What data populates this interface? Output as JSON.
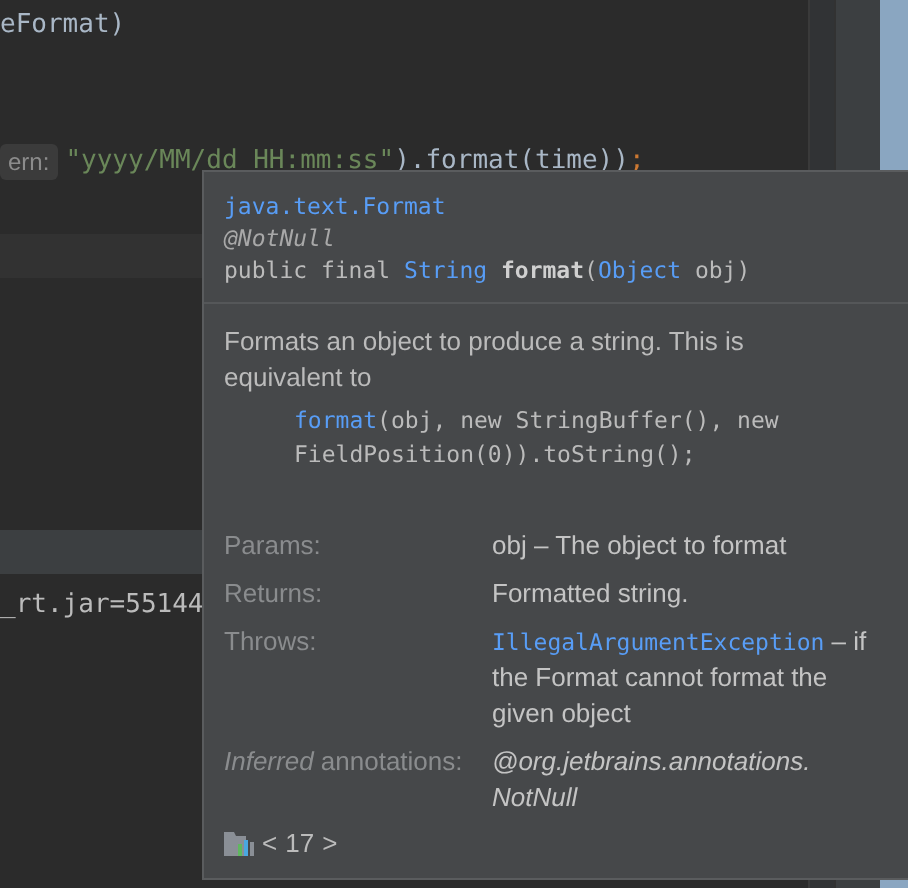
{
  "editor": {
    "lines": [
      {
        "kind": "code",
        "tokens": [
          {
            "text": "eFormat)",
            "kind": "plain"
          }
        ]
      },
      {
        "kind": "blank"
      },
      {
        "kind": "blank"
      },
      {
        "kind": "hint",
        "hint": "ern:",
        "tokens": [
          {
            "text": "\"yyyy/MM/dd HH:mm:ss\"",
            "kind": "string"
          },
          {
            "text": ").format(time))",
            "kind": "plain"
          },
          {
            "text": ";",
            "kind": "punct"
          }
        ]
      },
      {
        "kind": "blank"
      },
      {
        "kind": "current"
      }
    ]
  },
  "console": {
    "line": "_rt.jar=55144"
  },
  "popup": {
    "qualified_name": "java.text.Format",
    "annotation": "@NotNull",
    "signature": [
      {
        "text": "public final ",
        "kind": "plain"
      },
      {
        "text": "String",
        "kind": "type"
      },
      {
        "text": " format",
        "kind": "name"
      },
      {
        "text": "(",
        "kind": "plain"
      },
      {
        "text": "Object",
        "kind": "type"
      },
      {
        "text": " obj)",
        "kind": "plain"
      }
    ],
    "description": "Formats an object to produce a string. This is equivalent to",
    "code_lines": [
      [
        {
          "text": "format",
          "kind": "link"
        },
        {
          "text": "(obj, new StringBuffer(), new",
          "kind": "plain"
        }
      ],
      [
        {
          "text": "FieldPosition(0)).toString();",
          "kind": "plain"
        }
      ]
    ],
    "sections": [
      {
        "label": "Params:",
        "kind": "text",
        "value": "obj – The object to format"
      },
      {
        "label": "Returns:",
        "kind": "text",
        "value": "Formatted string."
      },
      {
        "label": "Throws:",
        "kind": "exception",
        "link": "IllegalArgumentException",
        "value": " – if the Format cannot format the given object"
      },
      {
        "label": "*Inferred* annotations:",
        "kind": "italic",
        "value_lines": [
          "@org.jetbrains.annotations.",
          "NotNull"
        ]
      }
    ],
    "footer": {
      "prev": "<",
      "count": "17",
      "next": ">"
    }
  }
}
